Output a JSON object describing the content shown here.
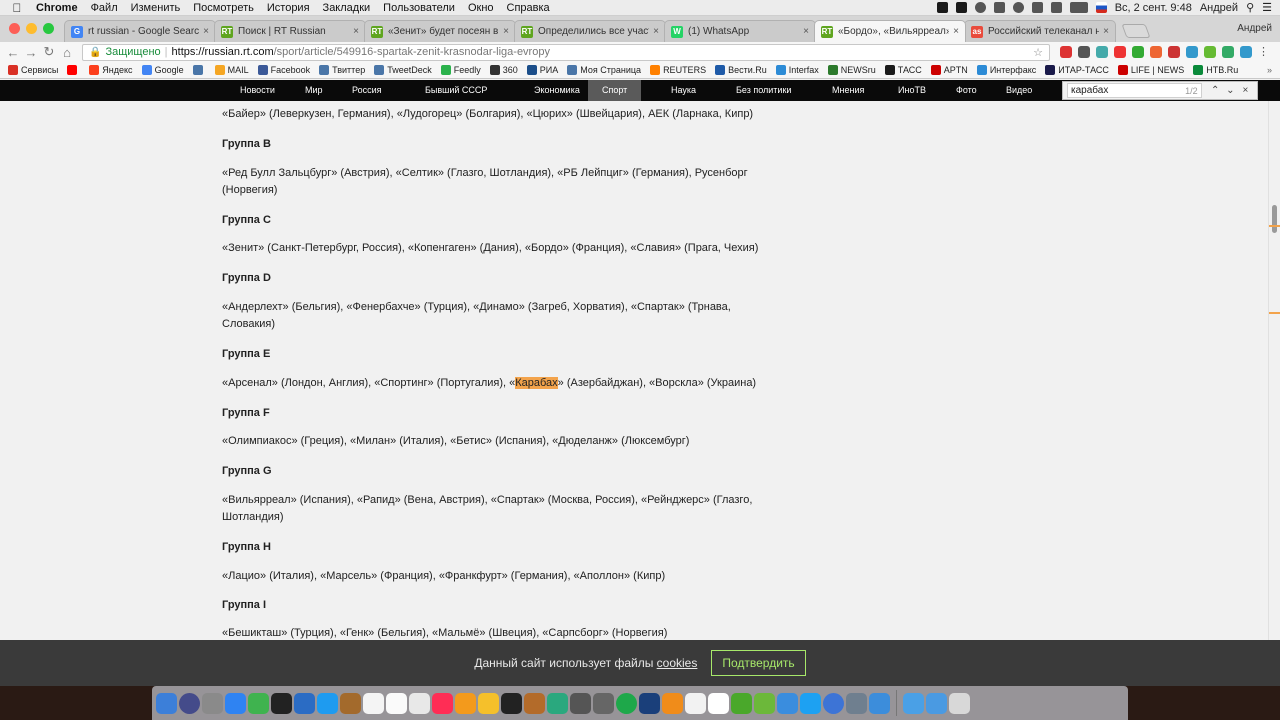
{
  "menubar": {
    "app": "Chrome",
    "menus": [
      "Файл",
      "Изменить",
      "Посмотреть",
      "История",
      "Закладки",
      "Пользователи",
      "Окно",
      "Справка"
    ],
    "clock": "Вс, 2 сент.  9:48",
    "user": "Андрей"
  },
  "tabs": [
    {
      "title": "rt russian - Google Search",
      "color": "#4285f4",
      "glyph": "G"
    },
    {
      "title": "Поиск | RT Russian",
      "color": "#5fa51f",
      "glyph": "RT"
    },
    {
      "title": "«Зенит» будет посеян в пер…",
      "color": "#5fa51f",
      "glyph": "RT"
    },
    {
      "title": "Определились все участник…",
      "color": "#5fa51f",
      "glyph": "RT"
    },
    {
      "title": "(1) WhatsApp",
      "color": "#25d366",
      "glyph": "W"
    },
    {
      "title": "«Бордо», «Вильярреал» и «…",
      "color": "#5fa51f",
      "glyph": "RT",
      "active": true
    },
    {
      "title": "Российский телеканал наза…",
      "color": "#e94b3c",
      "glyph": "as"
    }
  ],
  "profile": "Андрей",
  "address": {
    "secure_label": "Защищено",
    "host": "https://russian.rt.com",
    "path": "/sport/article/549916-spartak-zenit-krasnodar-liga-evropy"
  },
  "bookmarks": [
    {
      "label": "Сервисы",
      "color": "#d93025"
    },
    {
      "label": "",
      "color": "#ff0000"
    },
    {
      "label": "Яндекс",
      "color": "#fc3f1d"
    },
    {
      "label": "Google",
      "color": "#4285f4"
    },
    {
      "label": "",
      "color": "#4a76a8"
    },
    {
      "label": "MAIL",
      "color": "#f5a623"
    },
    {
      "label": "Facebook",
      "color": "#3b5998"
    },
    {
      "label": "Твиттер",
      "color": "#4a76a8"
    },
    {
      "label": "TweetDeck",
      "color": "#4a76a8"
    },
    {
      "label": "Feedly",
      "color": "#2bb24c"
    },
    {
      "label": "360",
      "color": "#333333"
    },
    {
      "label": "РИА",
      "color": "#1b4e8a"
    },
    {
      "label": "Моя Страница",
      "color": "#4a76a8"
    },
    {
      "label": "REUTERS",
      "color": "#ff8000"
    },
    {
      "label": "Вести.Ru",
      "color": "#1e5aa8"
    },
    {
      "label": "Interfax",
      "color": "#2c8bd6"
    },
    {
      "label": "NEWSru",
      "color": "#2c7a2c"
    },
    {
      "label": "ТАСС",
      "color": "#1a1a1a"
    },
    {
      "label": "APTN",
      "color": "#cc0000"
    },
    {
      "label": "Интерфакс",
      "color": "#2c8bd6"
    },
    {
      "label": "ИТАР-ТАСС",
      "color": "#1a1a4a"
    },
    {
      "label": "LIFE | NEWS",
      "color": "#cc0000"
    },
    {
      "label": "НТВ.Ru",
      "color": "#0a8a3a"
    }
  ],
  "sitenav": [
    "Новости",
    "Мир",
    "Россия",
    "Бывший СССР",
    "Экономика",
    "Спорт",
    "Наука",
    "Без политики",
    "Мнения",
    "ИноТВ",
    "Фото",
    "Видео"
  ],
  "sitenav_active": "Спорт",
  "find": {
    "query": "карабах",
    "count": "1/2"
  },
  "article": [
    {
      "type": "text",
      "text": "«Байер» (Леверкузен, Германия), «Лудогорец» (Болгария), «Цюрих» (Швейцария), АЕК (Ларнака, Кипр)"
    },
    {
      "type": "head",
      "text": "Группа B"
    },
    {
      "type": "text",
      "text": "«Ред Булл Зальцбург» (Австрия), «Селтик» (Глазго, Шотландия), «РБ Лейпциг» (Германия), Русенборг (Норвегия)"
    },
    {
      "type": "head",
      "text": "Группа C"
    },
    {
      "type": "text",
      "text": "«Зенит» (Санкт-Петербург, Россия), «Копенгаген» (Дания), «Бордо» (Франция), «Славия» (Прага, Чехия)"
    },
    {
      "type": "head",
      "text": "Группа D"
    },
    {
      "type": "text",
      "text": "«Андерлехт» (Бельгия), «Фенербахче» (Турция), «Динамо» (Загреб, Хорватия), «Спартак» (Трнава, Словакия)"
    },
    {
      "type": "head",
      "text": "Группа E"
    },
    {
      "type": "text_hl",
      "before": "«Арсенал» (Лондон, Англия), «Спортинг» (Португалия), «",
      "highlight": "Карабах",
      "after": "» (Азербайджан), «Ворскла» (Украина)"
    },
    {
      "type": "head",
      "text": "Группа F"
    },
    {
      "type": "text",
      "text": "«Олимпиакос» (Греция), «Милан» (Италия), «Бетис» (Испания), «Дюделанж» (Люксембург)"
    },
    {
      "type": "head",
      "text": "Группа G"
    },
    {
      "type": "text",
      "text": "«Вильярреал» (Испания), «Рапид» (Вена, Австрия), «Спартак» (Москва, Россия), «Рейнджерс» (Глазго, Шотландия)"
    },
    {
      "type": "head",
      "text": "Группа H"
    },
    {
      "type": "text",
      "text": "«Лацио» (Италия), «Марсель» (Франция), «Франкфурт» (Германия), «Аполлон» (Кипр)"
    },
    {
      "type": "head",
      "text": "Группа I"
    },
    {
      "type": "text",
      "text": "«Бешикташ» (Турция), «Генк» (Бельгия), «Мальмё» (Швеция), «Сарпсборг» (Норвегия)"
    }
  ],
  "cookie": {
    "text_before": "Данный сайт использует файлы ",
    "link": "cookies",
    "button": "Подтвердить"
  },
  "dock_colors": [
    "#3c7fd9",
    "#444b8a",
    "#8a8a8a",
    "#2f83f2",
    "#3fb34f",
    "#222222",
    "#2b6cc4",
    "#1e9bf0",
    "#a36a2c",
    "#f4f4f4",
    "#fafafa",
    "#e8e8e8",
    "#ff2d55",
    "#f39a1c",
    "#f5c02b",
    "#222222",
    "#b36b2a",
    "#2aa87e",
    "#555555",
    "#666666",
    "#1ea84a",
    "#1a3f7a",
    "#f08c1a",
    "#f2f2f2",
    "#ffffff",
    "#4aa82b",
    "#6cb83a",
    "#3a8dde",
    "#1da1f2",
    "#3d74d6",
    "#6f7f8f",
    "#3c8ddb",
    "#4aa0e6",
    "#4a9ae2",
    "#d8d8d8"
  ]
}
